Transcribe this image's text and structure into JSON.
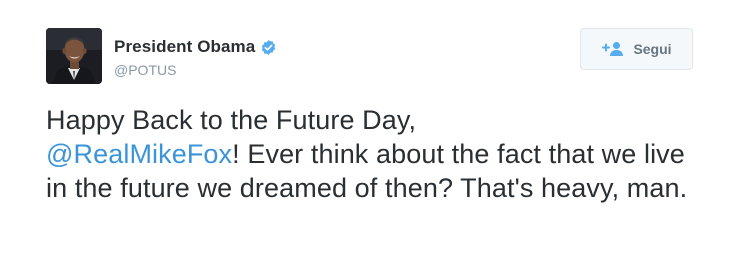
{
  "tweet": {
    "author": {
      "display_name": "President Obama",
      "screen_name": "@POTUS",
      "verified": true,
      "verified_color": "#55acee"
    },
    "follow_button": {
      "label": "Segui",
      "icon": "add-user-icon",
      "icon_color": "#55acee"
    },
    "text": {
      "line1": "Happy Back to the Future Day,",
      "mention": "@RealMikeFox",
      "after_mention": "! Ever think about the fact that we live in the future we dreamed of then? That's heavy, man.",
      "mention_color": "#3b94d9"
    }
  }
}
